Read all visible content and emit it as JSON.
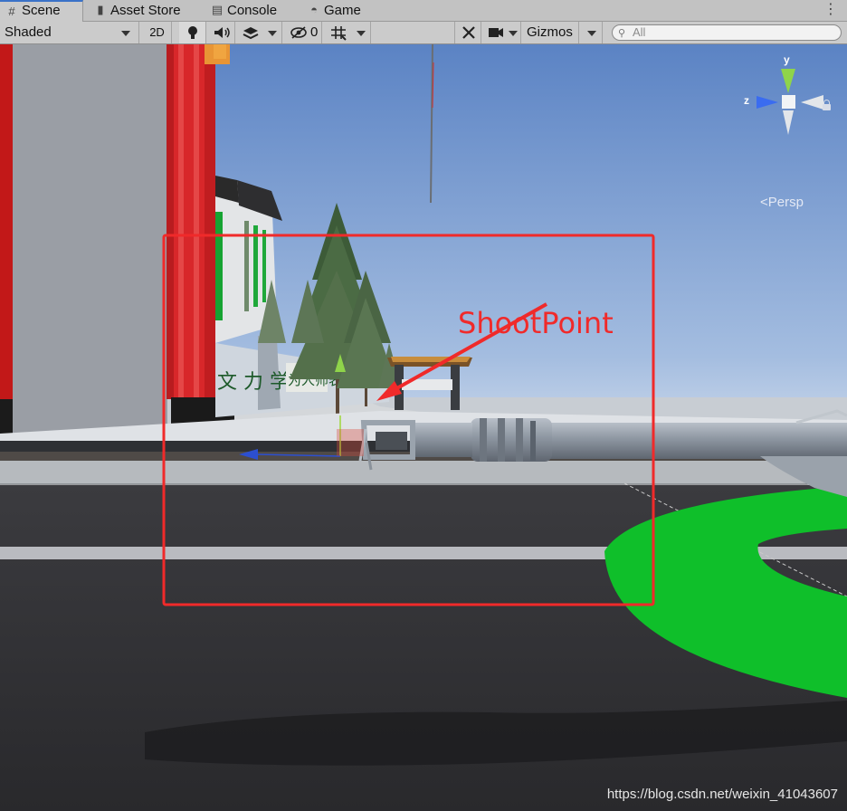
{
  "tabs": [
    {
      "label": "Scene",
      "icon": "grid-icon",
      "active": true
    },
    {
      "label": "Asset Store",
      "icon": "bag-icon"
    },
    {
      "label": "Console",
      "icon": "console-icon"
    },
    {
      "label": "Game",
      "icon": "gamepad-icon"
    }
  ],
  "toolbar": {
    "shading_mode": "Shaded",
    "mode_2d": "2D",
    "hidden_count": "0",
    "gizmos": "Gizmos",
    "search_placeholder": "All"
  },
  "gizmo": {
    "y": "y",
    "z": "z",
    "persp": "Persp"
  },
  "annotation": {
    "label": "ShootPoint",
    "color": "#f02a2a"
  },
  "watermark": "https://blog.csdn.net/weixin_41043607",
  "colors": {
    "accent": "#3a72c8",
    "target_ring": "#0fbf2a",
    "sky": "#5f87c8"
  }
}
